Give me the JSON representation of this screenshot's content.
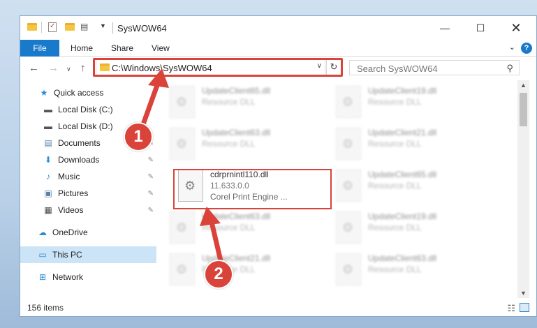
{
  "window": {
    "title": "SysWOW64"
  },
  "ribbon": {
    "file": "File",
    "tabs": [
      "Home",
      "Share",
      "View"
    ]
  },
  "address": {
    "path": "C:\\Windows\\SysWOW64"
  },
  "search": {
    "placeholder": "Search SysWOW64"
  },
  "nav": {
    "items": [
      {
        "label": "Quick access",
        "icon": "star-icon"
      },
      {
        "label": "Local Disk (C:)",
        "icon": "drive-icon"
      },
      {
        "label": "Local Disk (D:)",
        "icon": "drive-icon"
      },
      {
        "label": "Documents",
        "icon": "documents-icon"
      },
      {
        "label": "Downloads",
        "icon": "download-icon"
      },
      {
        "label": "Music",
        "icon": "music-icon"
      },
      {
        "label": "Pictures",
        "icon": "pictures-icon"
      },
      {
        "label": "Videos",
        "icon": "videos-icon"
      },
      {
        "label": "OneDrive",
        "icon": "cloud-icon"
      },
      {
        "label": "This PC",
        "icon": "computer-icon"
      },
      {
        "label": "Network",
        "icon": "network-icon"
      }
    ]
  },
  "files": {
    "left": [
      {
        "name": "UpdateClient65.dll",
        "type": "Resource DLL"
      },
      {
        "name": "UpdateClient63.dll",
        "type": "Resource DLL"
      },
      {
        "name": "cdrprnintl110.dll",
        "version": "11.633.0.0",
        "description": "Corel Print Engine ..."
      },
      {
        "name": "UpdateClient63.dll",
        "type": "Resource DLL"
      },
      {
        "name": "UpdateClient21.dll",
        "type": "Resource DLL"
      }
    ],
    "right": [
      {
        "name": "UpdateClient19.dll",
        "type": "Resource DLL"
      },
      {
        "name": "UpdateClient21.dll",
        "type": "Resource DLL"
      },
      {
        "name": "UpdateClient65.dll",
        "type": "Resource DLL"
      },
      {
        "name": "UpdateClient19.dll",
        "type": "Resource DLL"
      },
      {
        "name": "UpdateClient63.dll",
        "type": "Resource DLL"
      }
    ]
  },
  "status": {
    "count": "156 items"
  },
  "callouts": {
    "one": "1",
    "two": "2"
  },
  "colors": {
    "accent": "#1979ca",
    "highlight": "#d9433a",
    "selected": "#cce4f7"
  }
}
